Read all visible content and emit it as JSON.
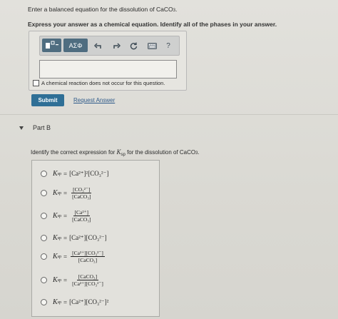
{
  "partA": {
    "prompt_prefix": "Enter a balanced equation for the dissolution of CaCO",
    "prompt_sub": "3",
    "prompt_suffix": ".",
    "instruction": "Express your answer as a chemical equation. Identify all of the phases in your answer.",
    "toolbar": {
      "template_icon": "template-icon",
      "greek_label": "ΑΣΦ",
      "undo_icon": "undo-icon",
      "redo_icon": "redo-icon",
      "refresh_icon": "refresh-icon",
      "keyboard_icon": "keyboard-icon",
      "help_label": "?"
    },
    "input_value": "",
    "checkbox_label": "A chemical reaction does not occur for this question.",
    "submit_label": "Submit",
    "request_answer_label": "Request Answer"
  },
  "partB": {
    "title": "Part B",
    "prompt_prefix": "Identify the correct expression for ",
    "prompt_k": "K",
    "prompt_ksub": "sp",
    "prompt_suffix": " for the dissolution of CaCO",
    "prompt_sub": "3",
    "prompt_end": ".",
    "k_label": "K",
    "k_sub": "sp",
    "eq": "=",
    "options": [
      {
        "type": "inline",
        "expr": "[Ca²⁺]²[CO₃²⁻]"
      },
      {
        "type": "frac",
        "num": "[CO₃²⁻]",
        "den": "[CaCO₃]"
      },
      {
        "type": "frac",
        "num": "[Ca²⁺]",
        "den": "[CaCO₃]"
      },
      {
        "type": "inline",
        "expr": "[Ca²⁺][CO₃²⁻]"
      },
      {
        "type": "frac",
        "num": "[Ca²⁺][CO₃²⁻]",
        "den": "[CaCO₃]"
      },
      {
        "type": "frac",
        "num": "[CaCO₃]",
        "den": "[Ca²⁺][CO₃²⁻]"
      },
      {
        "type": "inline",
        "expr": "[Ca²⁺][CO₃²⁻]²"
      }
    ]
  },
  "colors": {
    "submit_bg": "#2f6f96",
    "link": "#2e5a8a",
    "toolbar_button": "#4f6d80"
  }
}
